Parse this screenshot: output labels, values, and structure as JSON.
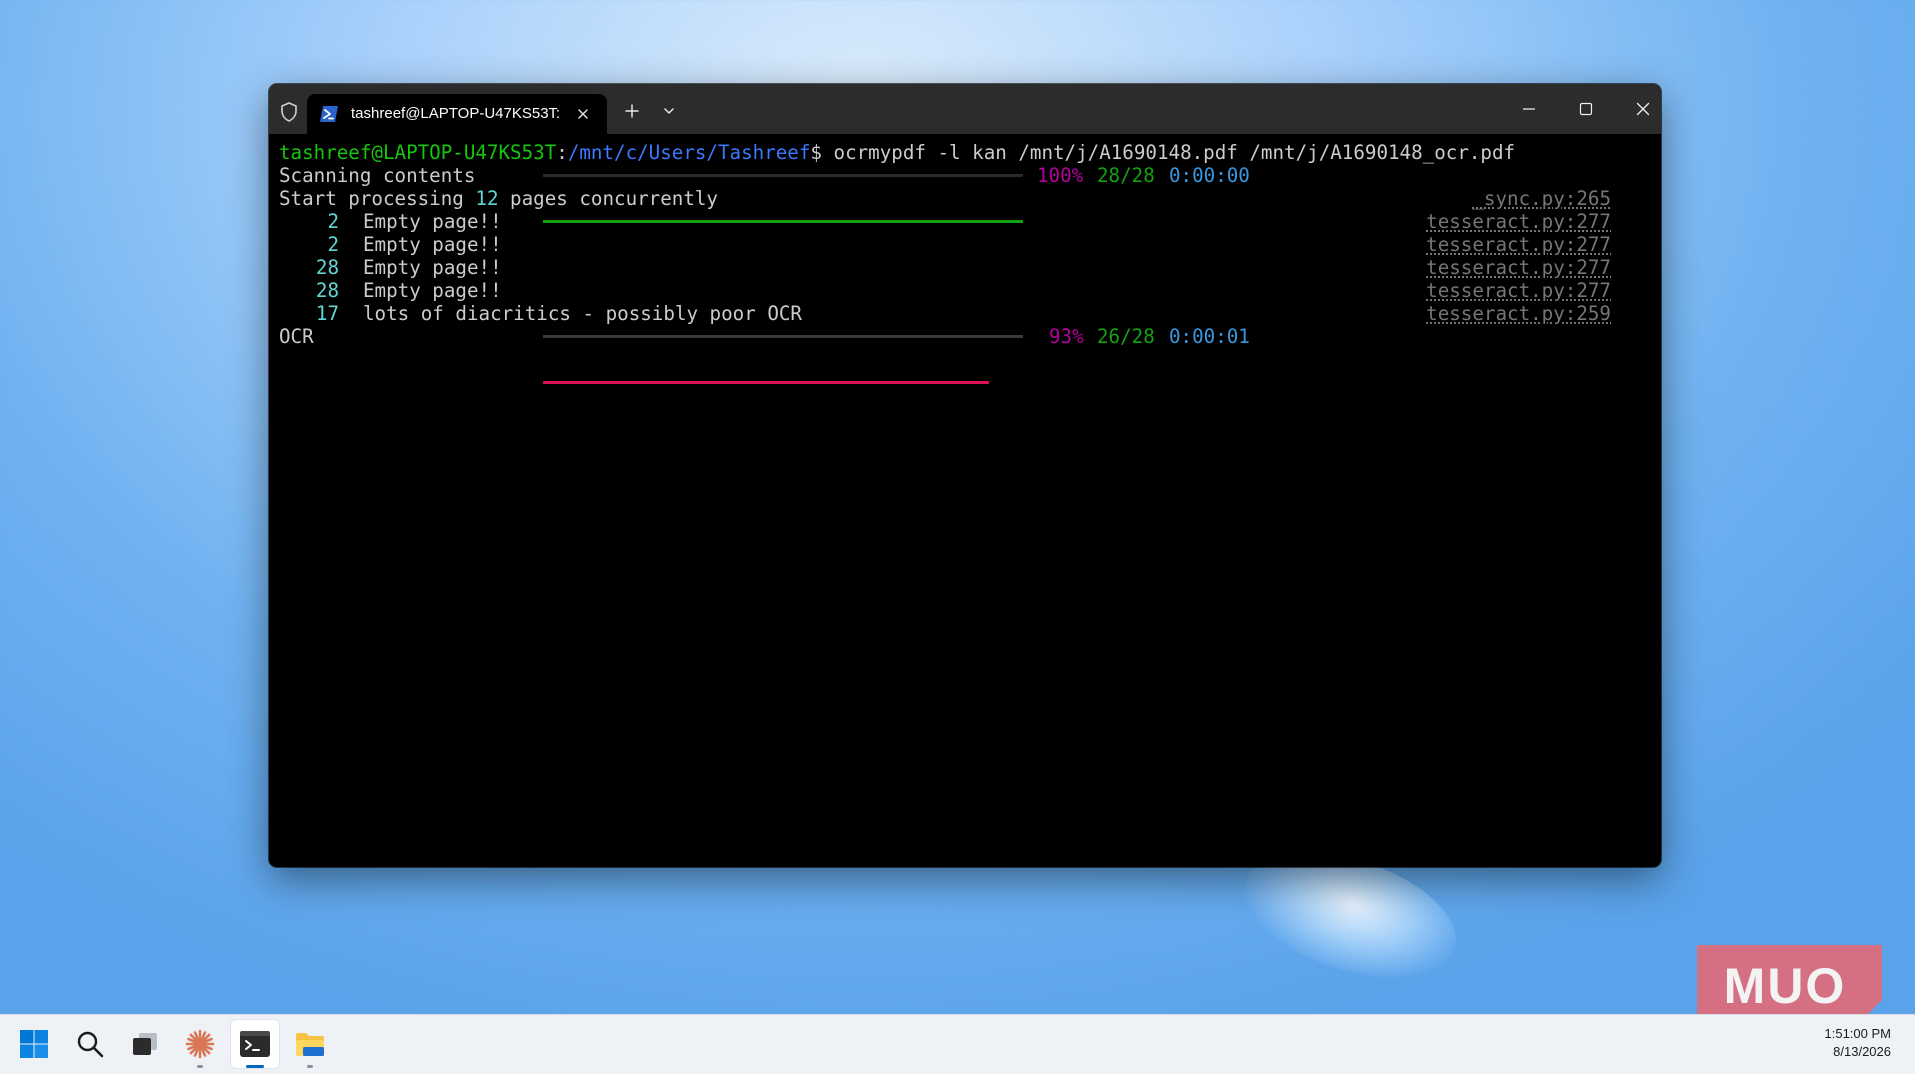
{
  "window": {
    "tab_title": "tashreef@LAPTOP-U47KS53T:",
    "icons": [
      "shield-icon",
      "powershell-icon",
      "close-icon",
      "plus-icon",
      "chevron-down-icon",
      "minimize-icon",
      "maximize-icon",
      "close-icon"
    ]
  },
  "terminal": {
    "prompt_user": "tashreef@LAPTOP-U47KS53T",
    "prompt_colon": ":",
    "prompt_path": "/mnt/c/Users/Tashreef",
    "prompt_symbol": "$ ",
    "command": "ocrmypdf -l kan /mnt/j/A1690148.pdf /mnt/j/A1690148_ocr.pdf",
    "scan": {
      "label": "Scanning contents",
      "percent": "100%",
      "count": "28/28",
      "time": "0:00:00",
      "progress": 1.0
    },
    "start": {
      "prefix": "Start processing ",
      "count": "12",
      "suffix": " pages concurrently",
      "source": "_sync.py:265"
    },
    "log": [
      {
        "page": "2",
        "message": "Empty page!!",
        "source": "tesseract.py:277"
      },
      {
        "page": "2",
        "message": "Empty page!!",
        "source": "tesseract.py:277"
      },
      {
        "page": "28",
        "message": "Empty page!!",
        "source": "tesseract.py:277"
      },
      {
        "page": "28",
        "message": "Empty page!!",
        "source": "tesseract.py:277"
      },
      {
        "page": "17",
        "message": "lots of diacritics - possibly poor OCR",
        "source": "tesseract.py:259"
      }
    ],
    "ocr": {
      "label": "OCR",
      "percent": "93%",
      "count": "26/28",
      "time": "0:00:01",
      "progress": 0.93
    }
  },
  "watermark": {
    "text": "MUO"
  },
  "taskbar": {
    "items": [
      "windows-start-icon",
      "search-icon",
      "task-view-icon",
      "claude-icon",
      "terminal-icon",
      "file-explorer-icon"
    ],
    "time": "1:51:00 PM",
    "date": "8/13/2026"
  },
  "colors": {
    "scan_bar": "#13a10e",
    "ocr_bar": "#e01053",
    "percent": "#b4009e",
    "count": "#13a10e",
    "time": "#3a96dd"
  }
}
